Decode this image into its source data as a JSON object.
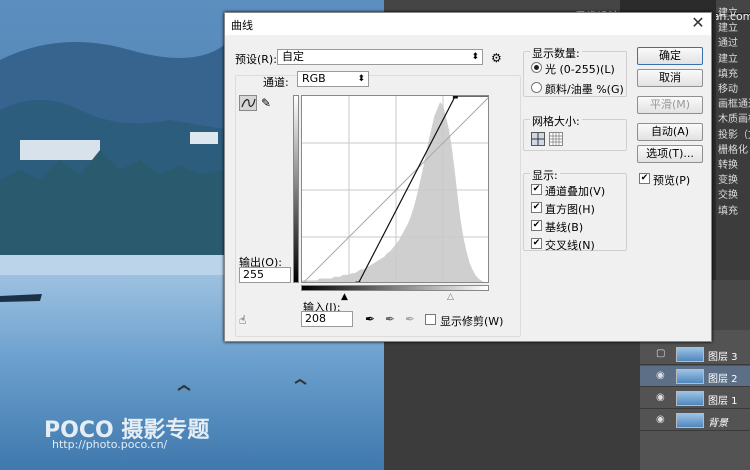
{
  "background": {
    "top_right_text": "思缘设计论坛 www.missyuan.com",
    "watermark_logo": "POCO 摄影专题",
    "watermark_url": "http://photo.poco.cn/",
    "right_panel_items": [
      "建立",
      "建立",
      "通过",
      "建立",
      "填充",
      "移动",
      "画框通过",
      "木质画框",
      "投影（文",
      "栅格化",
      "转换",
      "变换",
      "交换",
      "填充"
    ],
    "layers": [
      {
        "name": "图层 3",
        "visible": false,
        "selected": false
      },
      {
        "name": "图层 2",
        "visible": true,
        "selected": true
      },
      {
        "name": "图层 1",
        "visible": true,
        "selected": false
      },
      {
        "name": "背景",
        "visible": true,
        "selected": false
      }
    ],
    "eye_icon_char": "◉"
  },
  "dialog": {
    "title": "曲线",
    "close_char": "✕",
    "preset_label": "预设(R):",
    "preset_value": "自定",
    "channel_label": "通道:",
    "channel_value": "RGB",
    "output_label": "输出(O):",
    "output_value": "255",
    "input_label": "输入(I):",
    "input_value": "208",
    "show_clipping_label": "显示修剪(W)",
    "show_clipping_checked": false,
    "show_amount": {
      "group_label": "显示数量:",
      "option_light": "光 (0-255)(L)",
      "option_pigment": "颜料/油墨 %(G)",
      "selected": "light"
    },
    "grid_size_label": "网格大小:",
    "show": {
      "group_label": "显示:",
      "options": [
        {
          "label": "通道叠加(V)",
          "checked": true
        },
        {
          "label": "直方图(H)",
          "checked": true
        },
        {
          "label": "基线(B)",
          "checked": true
        },
        {
          "label": "交叉线(N)",
          "checked": true
        }
      ]
    },
    "buttons": {
      "ok": "确定",
      "cancel": "取消",
      "smooth": "平滑(M)",
      "auto": "自动(A)",
      "options": "选项(T)..."
    },
    "preview_label": "预览(P)",
    "preview_checked": true,
    "curve": {
      "points": [
        [
          0,
          0
        ],
        [
          76,
          0
        ],
        [
          208,
          255
        ],
        [
          255,
          255
        ]
      ]
    },
    "histogram": [
      2,
      2,
      2,
      2,
      2,
      2,
      3,
      3,
      3,
      3,
      3,
      4,
      4,
      4,
      5,
      5,
      5,
      6,
      6,
      7,
      8,
      8,
      9,
      10,
      11,
      12,
      13,
      14,
      15,
      17,
      18,
      20,
      22,
      24,
      27,
      30,
      33,
      37,
      42,
      48,
      55,
      62,
      70,
      78,
      85,
      92,
      96,
      100,
      98,
      92,
      85,
      75,
      62,
      48,
      35,
      25,
      18,
      12,
      8,
      5,
      3,
      2,
      1,
      1
    ]
  }
}
